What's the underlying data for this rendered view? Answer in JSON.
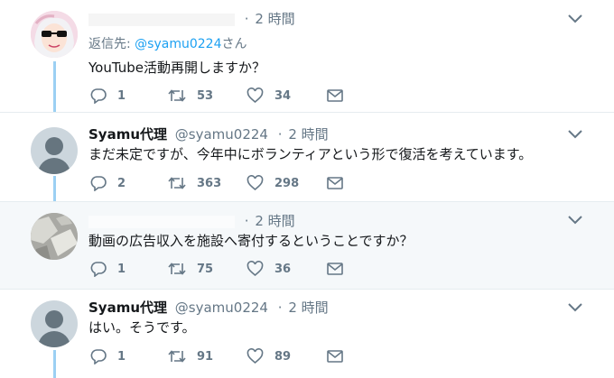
{
  "tweets": [
    {
      "name": "",
      "handle": "",
      "time": "2 時間",
      "reply_prefix": "返信先: ",
      "reply_mention": "@syamu0224",
      "reply_suffix": "さん",
      "text": "YouTube活動再開しますか？",
      "replies": "1",
      "retweets": "53",
      "likes": "34"
    },
    {
      "name": "Syamu代理",
      "handle": "@syamu0224",
      "time": "2 時間",
      "text": "まだ未定ですが、今年中にボランティアという形で復活を考えています。",
      "replies": "2",
      "retweets": "363",
      "likes": "298"
    },
    {
      "name": "",
      "handle": "",
      "time": "2 時間",
      "text": "動画の広告収入を施設へ寄付するということですか？",
      "replies": "1",
      "retweets": "75",
      "likes": "36"
    },
    {
      "name": "Syamu代理",
      "handle": "@syamu0224",
      "time": "2 時間",
      "text": "はい。そうです。",
      "replies": "1",
      "retweets": "91",
      "likes": "89"
    }
  ],
  "separator": "·",
  "icons": {
    "reply": "reply-icon",
    "retweet": "retweet-icon",
    "like": "heart-icon",
    "message": "envelope-icon",
    "menu": "chevron-down-icon"
  },
  "colors": {
    "thread_line": "#9bd0f3",
    "mention": "#1da1f2",
    "muted": "#657786",
    "highlight_bg": "#f5f8fa"
  }
}
